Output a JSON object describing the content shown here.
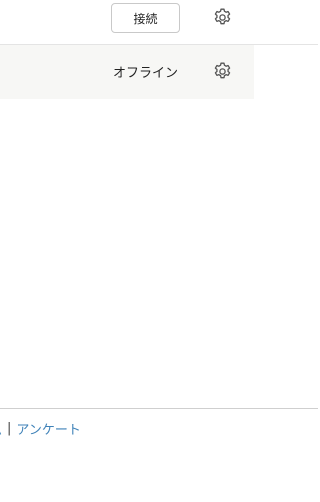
{
  "account_rows": [
    {
      "action_button_label": "接続",
      "settings_icon": "gear-icon"
    },
    {
      "status_label": "オフライン",
      "settings_icon": "gear-icon"
    }
  ],
  "footer": {
    "links": [
      {
        "label": "ム"
      },
      {
        "label": "アンケート"
      }
    ],
    "separator": "|"
  },
  "colors": {
    "link": "#3f82b8",
    "row_highlight": "#f7f7f5",
    "divider": "#cfcfcf"
  }
}
